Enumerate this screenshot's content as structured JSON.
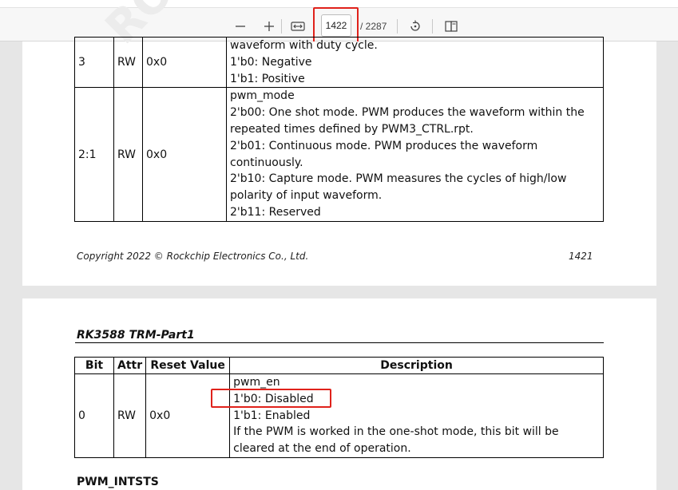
{
  "toolbar": {
    "zoom_out_icon": "minus-icon",
    "zoom_in_icon": "plus-icon",
    "fit_icon": "fit-width-icon",
    "current_page": "1422",
    "total_pages": "/ 2287",
    "rotate_icon": "rotate-icon",
    "spread_icon": "two-page-icon"
  },
  "page1": {
    "rows": [
      {
        "bit": "3",
        "attr": "RW",
        "reset": "0x0",
        "desc": [
          "waveform with duty cycle.",
          "1'b0: Negative",
          "1'b1: Positive"
        ]
      },
      {
        "bit": "2:1",
        "attr": "RW",
        "reset": "0x0",
        "desc": [
          "pwm_mode",
          "2'b00: One shot mode. PWM produces the waveform within the",
          "repeated times defined by PWM3_CTRL.rpt.",
          "2'b01: Continuous mode. PWM produces the waveform",
          "continuously.",
          "2'b10: Capture mode. PWM measures the cycles of high/low",
          "polarity of input waveform.",
          "2'b11: Reserved"
        ]
      }
    ],
    "footer_left": "Copyright 2022 © Rockchip Electronics Co., Ltd.",
    "footer_right": "1421",
    "watermark": "RO"
  },
  "page2": {
    "title": "RK3588 TRM-Part1",
    "headers": {
      "bit": "Bit",
      "attr": "Attr",
      "reset": "Reset Value",
      "desc": "Description"
    },
    "row": {
      "bit": "0",
      "attr": "RW",
      "reset": "0x0",
      "desc": [
        "pwm_en",
        "1'b0: Disabled",
        "1'b1: Enabled",
        "If the PWM is worked in the one-shot mode, this bit will be",
        "cleared at the end of operation."
      ]
    },
    "next_heading": "PWM_INTSTS"
  },
  "highlight_color": "#e0221b"
}
